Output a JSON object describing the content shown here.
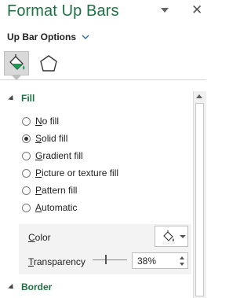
{
  "header": {
    "title": "Format Up Bars",
    "menu_icon": "chevron-down-icon",
    "close_icon": "close-icon",
    "close_glyph": "✕"
  },
  "options": {
    "label": "Up Bar Options",
    "chevron_icon": "chevron-down-icon"
  },
  "tabs": [
    {
      "name": "fill-line",
      "icon": "paint-bucket-icon",
      "selected": true
    },
    {
      "name": "effects",
      "icon": "pentagon-icon",
      "selected": false
    }
  ],
  "fill_section": {
    "title": "Fill",
    "options": [
      {
        "prefix": "",
        "accel": "N",
        "suffix": "o fill",
        "checked": false
      },
      {
        "prefix": "",
        "accel": "S",
        "suffix": "olid fill",
        "checked": true
      },
      {
        "prefix": "",
        "accel": "G",
        "suffix": "radient fill",
        "checked": false
      },
      {
        "prefix": "",
        "accel": "P",
        "suffix": "icture or texture fill",
        "checked": false
      },
      {
        "prefix": "",
        "accel": "P",
        "suffix": "attern fill",
        "checked": false
      },
      {
        "prefix": "",
        "accel": "A",
        "suffix": "utomatic",
        "checked": false
      }
    ],
    "color": {
      "prefix": "",
      "accel": "C",
      "suffix": "olor",
      "swatch_color": "#ffffff"
    },
    "transparency": {
      "prefix": "",
      "accel": "T",
      "suffix": "ransparency",
      "value": "38%",
      "level": 0.38
    }
  },
  "border_section": {
    "title": "Border"
  },
  "colors": {
    "accent": "#1e7145",
    "tab_selected": "#d9d9d9"
  }
}
